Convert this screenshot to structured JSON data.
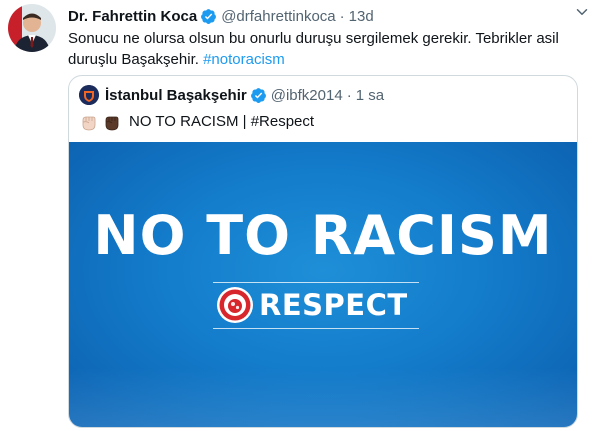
{
  "tweet": {
    "author_name": "Dr. Fahrettin Koca",
    "handle": "@drfahrettinkoca",
    "separator": "·",
    "time": "13d",
    "text_before": "Sonucu ne olursa olsun bu onurlu duruşu sergilemek gerekir. Tebrikler asil duruşlu Başakşehir. ",
    "hashtag": "#notoracism",
    "icons": {
      "verified": "verified-badge-icon",
      "more": "chevron-down-icon"
    }
  },
  "quoted": {
    "author_name": "İstanbul Başakşehir",
    "handle": "@ibfk2014",
    "separator": "·",
    "time": "1 sa",
    "text": "NO TO RACISM | #Respect",
    "emoji": [
      "raised-fist-light-icon",
      "raised-fist-dark-icon"
    ],
    "media": {
      "headline": "NO TO RACISM",
      "respect_label": "RESPECT",
      "badge": "uefa-badge-icon"
    }
  },
  "colors": {
    "link": "#1d9bf0",
    "secondary": "#536471",
    "media_blue": "#137ccb",
    "verified": "#1d9bf0"
  }
}
